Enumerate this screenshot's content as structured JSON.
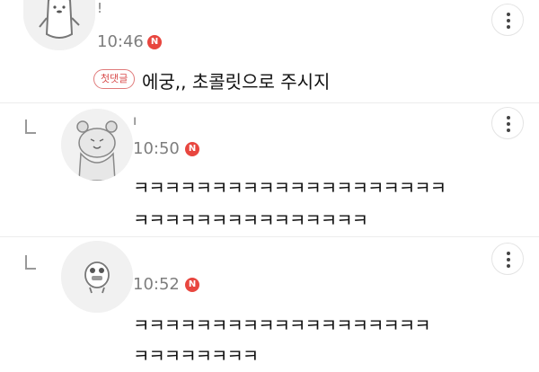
{
  "comments": [
    {
      "author": "!",
      "time": "10:46",
      "new_badge": "N",
      "first_comment_tag": "첫댓글",
      "text": "에궁,, 초콜릿으로 주시지",
      "avatar_icon": "penguin-icon",
      "is_reply": false
    },
    {
      "author": "ı",
      "time": "10:50",
      "new_badge": "N",
      "lines": [
        "ㅋㅋㅋㅋㅋㅋㅋㅋㅋㅋㅋㅋㅋㅋㅋㅋㅋㅋㅋㅋ",
        "ㅋㅋㅋㅋㅋㅋㅋㅋㅋㅋㅋㅋㅋㅋㅋ"
      ],
      "avatar_icon": "bear-icon",
      "is_reply": true
    },
    {
      "author": "",
      "time": "10:52",
      "new_badge": "N",
      "lines": [
        "ㅋㅋㅋㅋㅋㅋㅋㅋㅋㅋㅋㅋㅋㅋㅋㅋㅋㅋㅋ",
        "ㅋㅋㅋㅋㅋㅋㅋㅋ"
      ],
      "avatar_icon": "chick-icon",
      "is_reply": true
    }
  ],
  "colors": {
    "badge": "#e8463f",
    "tag": "#d84b4b",
    "time": "#7e7e7e",
    "divider": "#ececec"
  }
}
